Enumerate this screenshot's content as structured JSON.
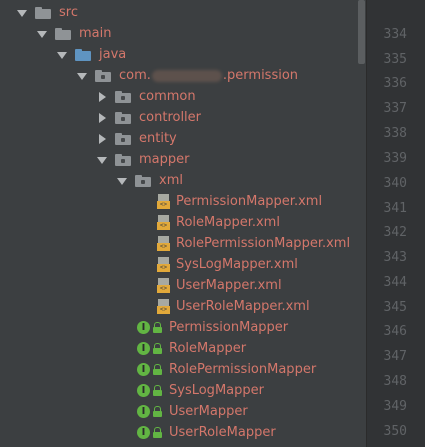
{
  "tree": {
    "src": "src",
    "main": "main",
    "java": "java",
    "package_prefix": "com.",
    "package_suffix": ".permission",
    "common": "common",
    "controller": "controller",
    "entity": "entity",
    "mapper": "mapper",
    "xml": "xml",
    "xml_files": [
      "PermissionMapper.xml",
      "RoleMapper.xml",
      "RolePermissionMapper.xml",
      "SysLogMapper.xml",
      "UserMapper.xml",
      "UserRoleMapper.xml"
    ],
    "interfaces": [
      "PermissionMapper",
      "RoleMapper",
      "RolePermissionMapper",
      "SysLogMapper",
      "UserMapper",
      "UserRoleMapper"
    ],
    "interface_badge": "I",
    "xml_badge": "<>"
  },
  "gutter": {
    "line_numbers": [
      "334",
      "335",
      "336",
      "337",
      "338",
      "339",
      "340",
      "341",
      "342",
      "343",
      "344",
      "345",
      "346",
      "347",
      "348",
      "349",
      "350"
    ]
  },
  "colors": {
    "panel_bg": "#3c3f41",
    "gutter_bg": "#313335",
    "folder_text": "#bbbbbb",
    "modified_text": "#d4776b",
    "interface_icon": "#62b543",
    "xml_badge": "#e2a93a"
  }
}
